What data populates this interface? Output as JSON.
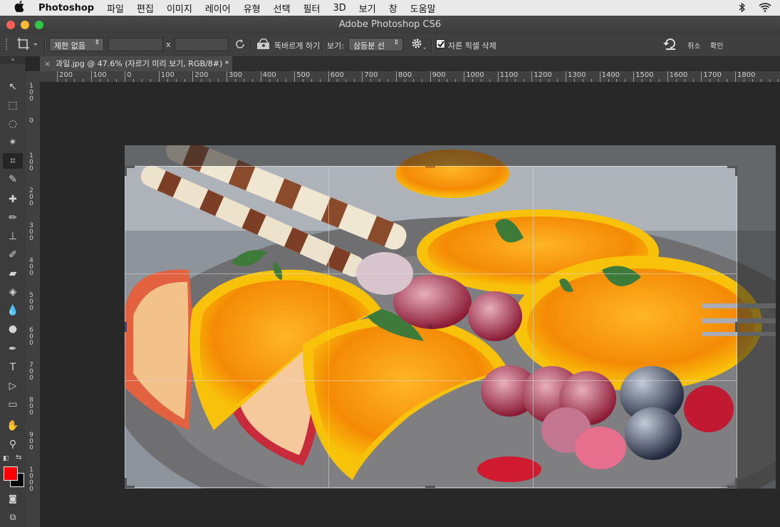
{
  "menubar": {
    "app_name": "Photoshop",
    "items": [
      "파일",
      "편집",
      "이미지",
      "레이어",
      "유형",
      "선택",
      "필터",
      "3D",
      "보기",
      "창",
      "도움말"
    ]
  },
  "window": {
    "title": "Adobe Photoshop CS6",
    "traffic_colors": [
      "#fc5f57",
      "#fdbc2e",
      "#33c748"
    ]
  },
  "options_bar": {
    "ratio_select": "제한 없음",
    "times_label": "x",
    "straighten_label": "똑바르게 하기",
    "view_label": "보기:",
    "view_select": "삼등분 선",
    "delete_cropped_label": "자른 픽셀 삭제",
    "delete_cropped_checked": true,
    "cancel_label": "취소",
    "confirm_label": "확인"
  },
  "document_tab": {
    "title": "과일.jpg @ 47.6% (자르기 미리 보기, RGB/8#) *",
    "close_label": "×"
  },
  "ruler": {
    "h_labels": [
      "200",
      "100",
      "0",
      "100",
      "200",
      "300",
      "400",
      "500",
      "600",
      "700",
      "800",
      "900",
      "1000",
      "1100",
      "1200",
      "1300",
      "1400",
      "1500",
      "1600",
      "1700",
      "1800"
    ],
    "v_labels": [
      "1\n0\n0",
      "0",
      "1\n0\n0",
      "2\n0\n0",
      "3\n0\n0",
      "4\n0\n0",
      "5\n0\n0",
      "6\n0\n0",
      "7\n0\n0",
      "8\n0\n0",
      "9\n0\n0",
      "1\n0\n0\n0"
    ]
  },
  "tools": [
    {
      "name": "move-tool-icon",
      "glyph": "↖"
    },
    {
      "name": "marquee-tool-icon",
      "glyph": "⬚"
    },
    {
      "name": "lasso-tool-icon",
      "glyph": "◌"
    },
    {
      "name": "magic-wand-tool-icon",
      "glyph": "✴"
    },
    {
      "name": "crop-tool-icon",
      "glyph": "⌗",
      "active": true
    },
    {
      "name": "eyedropper-tool-icon",
      "glyph": "✎"
    },
    {
      "name": "healing-brush-tool-icon",
      "glyph": "✚"
    },
    {
      "name": "brush-tool-icon",
      "glyph": "✏"
    },
    {
      "name": "clone-stamp-tool-icon",
      "glyph": "⊥"
    },
    {
      "name": "history-brush-tool-icon",
      "glyph": "✐"
    },
    {
      "name": "eraser-tool-icon",
      "glyph": "▰"
    },
    {
      "name": "paint-bucket-tool-icon",
      "glyph": "◈"
    },
    {
      "name": "blur-tool-icon",
      "glyph": "💧"
    },
    {
      "name": "dodge-tool-icon",
      "glyph": "●"
    },
    {
      "name": "pen-tool-icon",
      "glyph": "✒"
    },
    {
      "name": "type-tool-icon",
      "glyph": "T"
    },
    {
      "name": "path-selection-tool-icon",
      "glyph": "▷"
    },
    {
      "name": "rectangle-tool-icon",
      "glyph": "▭"
    },
    {
      "name": "hand-tool-icon",
      "glyph": "✋"
    },
    {
      "name": "zoom-tool-icon",
      "glyph": "⚲"
    }
  ],
  "colors": {
    "foreground": "#ff0000",
    "background": "#000000"
  }
}
